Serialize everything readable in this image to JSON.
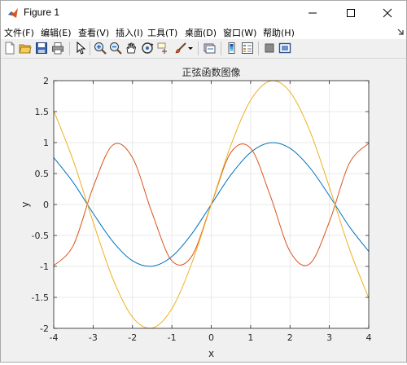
{
  "window": {
    "title": "Figure 1"
  },
  "menu": {
    "items": [
      {
        "label": "文件(F)"
      },
      {
        "label": "编辑(E)"
      },
      {
        "label": "查看(V)"
      },
      {
        "label": "插入(I)"
      },
      {
        "label": "工具(T)"
      },
      {
        "label": "桌面(D)"
      },
      {
        "label": "窗口(W)"
      },
      {
        "label": "帮助(H)"
      }
    ]
  },
  "toolbar": {
    "icons": [
      "new-figure-icon",
      "open-file-icon",
      "save-icon",
      "print-icon",
      "pointer-icon",
      "zoom-in-icon",
      "zoom-out-icon",
      "pan-hand-icon",
      "rotate-3d-icon",
      "data-cursor-icon",
      "brush-icon",
      "link-plot-icon",
      "colorbar-icon",
      "legend-icon",
      "hide-plot-tools-icon",
      "show-plot-tools-icon"
    ]
  },
  "chart_data": {
    "type": "line",
    "title": "正弦函数图像",
    "xlabel": "x",
    "ylabel": "y",
    "xlim": [
      -4,
      4
    ],
    "ylim": [
      -2,
      2
    ],
    "grid": true,
    "xticks": [
      "-4",
      "-3",
      "-2",
      "-1",
      "0",
      "1",
      "2",
      "3",
      "4"
    ],
    "yticks": [
      "-2",
      "-1.5",
      "-1",
      "-0.5",
      "0",
      "0.5",
      "1",
      "1.5",
      "2"
    ],
    "series": [
      {
        "formula": "sin(x)",
        "color": "#0072bd",
        "x": [
          -4,
          -3.5,
          -3,
          -2.5,
          -2,
          -1.5,
          -1,
          -0.5,
          0,
          0.5,
          1,
          1.5,
          2,
          2.5,
          3,
          3.5,
          4
        ],
        "y": [
          0.757,
          0.351,
          -0.141,
          -0.598,
          -0.909,
          -0.997,
          -0.841,
          -0.479,
          0,
          0.479,
          0.841,
          0.997,
          0.909,
          0.598,
          0.141,
          -0.351,
          -0.757
        ]
      },
      {
        "formula": "sin(2x)",
        "color": "#d95319",
        "x": [
          -4,
          -3.5,
          -3,
          -2.5,
          -2,
          -1.5,
          -1,
          -0.5,
          0,
          0.5,
          1,
          1.5,
          2,
          2.5,
          3,
          3.5,
          4
        ],
        "y": [
          -0.989,
          -0.657,
          0.279,
          0.959,
          0.757,
          -0.141,
          -0.909,
          -0.841,
          0,
          0.841,
          0.909,
          0.141,
          -0.757,
          -0.959,
          -0.279,
          0.657,
          0.989
        ]
      },
      {
        "formula": "2sin(x)",
        "color": "#edb120",
        "x": [
          -4,
          -3.5,
          -3,
          -2.5,
          -2,
          -1.5,
          -1,
          -0.5,
          0,
          0.5,
          1,
          1.5,
          2,
          2.5,
          3,
          3.5,
          4
        ],
        "y": [
          1.514,
          0.702,
          -0.282,
          -1.197,
          -1.819,
          -1.995,
          -1.683,
          -0.959,
          0,
          0.959,
          1.683,
          1.995,
          1.819,
          1.197,
          0.282,
          -0.702,
          -1.514
        ]
      }
    ]
  }
}
